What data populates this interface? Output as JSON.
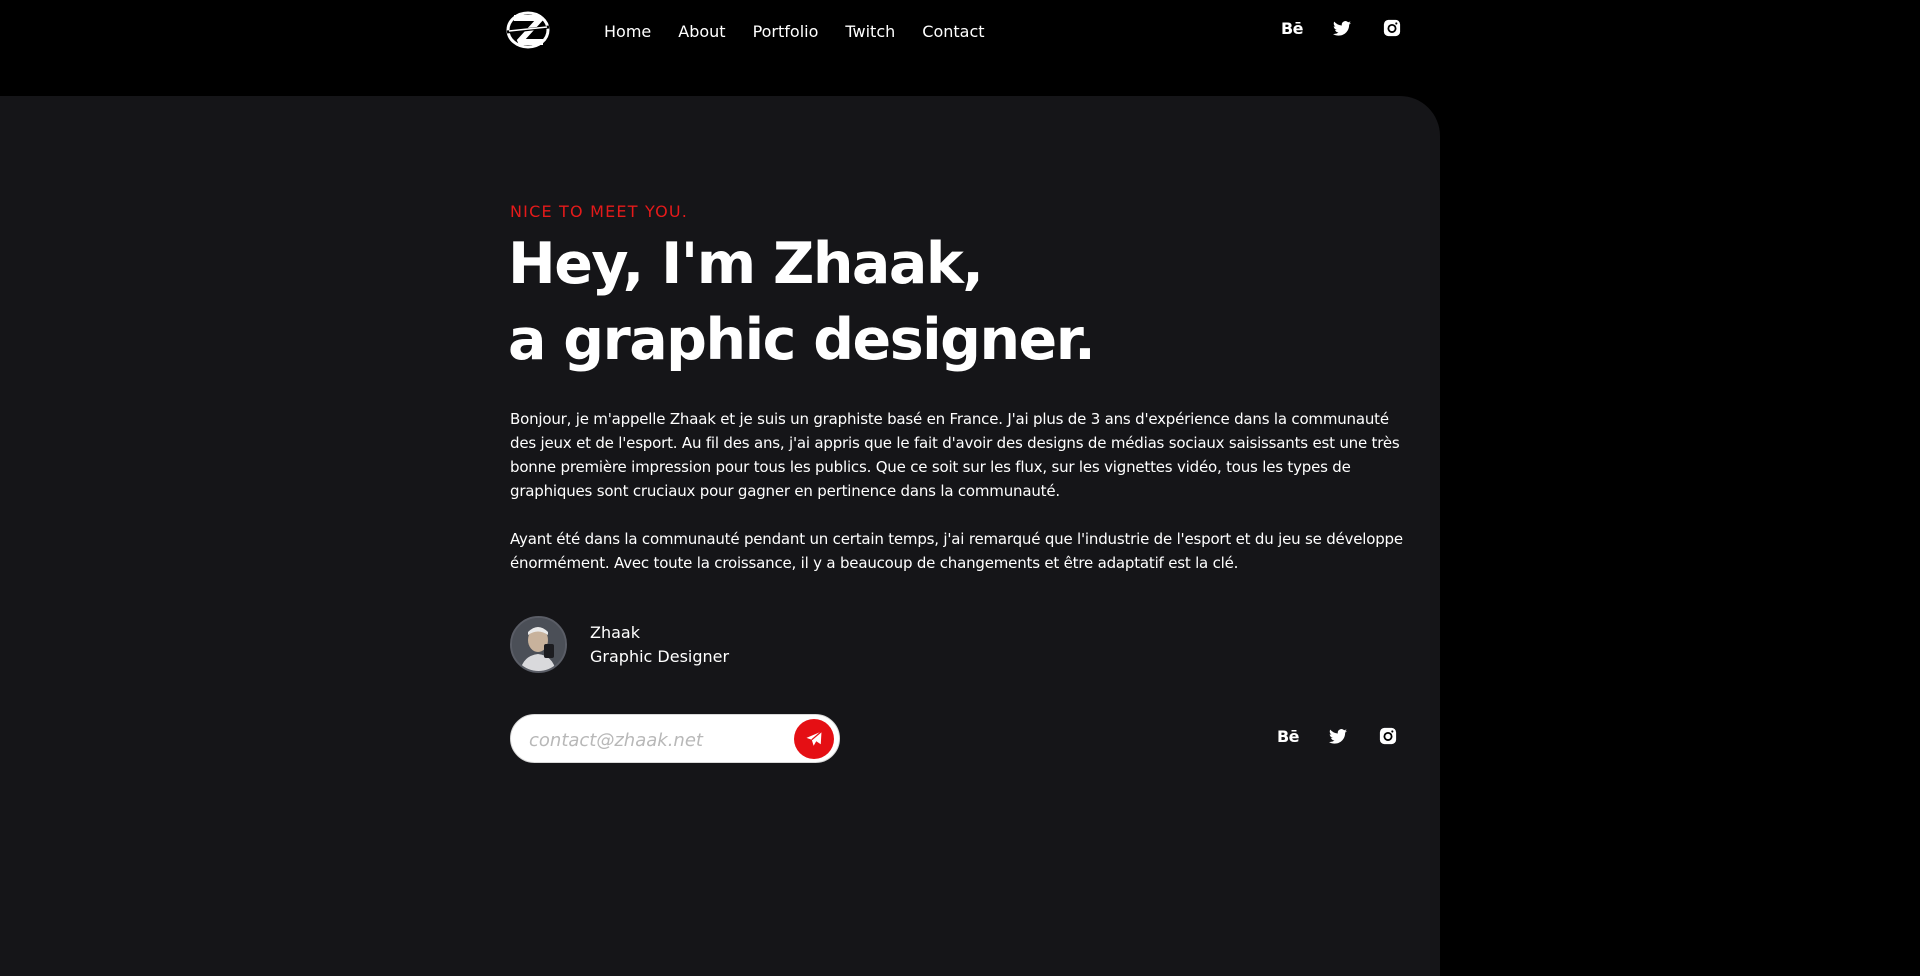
{
  "header": {
    "logo_letter": "Z",
    "nav": [
      {
        "label": "Home"
      },
      {
        "label": "About"
      },
      {
        "label": "Portfolio"
      },
      {
        "label": "Twitch"
      },
      {
        "label": "Contact"
      }
    ],
    "social": [
      {
        "label": "Bē",
        "icon": "behance-icon"
      },
      {
        "label": "",
        "icon": "twitter-icon"
      },
      {
        "label": "",
        "icon": "instagram-icon"
      }
    ]
  },
  "hero": {
    "kicker": "NICE TO MEET YOU.",
    "headline_line1": "Hey, I'm Zhaak,",
    "headline_line2": "a graphic designer.",
    "paragraph1": "Bonjour, je m'appelle Zhaak et je suis un graphiste basé en France. J'ai plus de 3 ans d'expérience dans la communauté des jeux et de l'esport. Au fil des ans, j'ai appris que le fait d'avoir des designs de médias sociaux saisissants est une très bonne première impression pour tous les publics. Que ce soit sur les flux, sur les vignettes vidéo, tous les types de graphiques sont cruciaux pour gagner en pertinence dans la communauté.",
    "paragraph2": "Ayant été dans la communauté pendant un certain temps, j'ai remarqué que l'industrie de l'esport et du jeu se développe énormément. Avec toute la croissance, il y a beaucoup de changements et être adaptatif est la clé."
  },
  "author": {
    "name": "Zhaak",
    "role": "Graphic Designer"
  },
  "contact": {
    "email_placeholder": "contact@zhaak.net",
    "email_value": "",
    "send_icon": "paper-plane-icon"
  },
  "colors": {
    "accent": "#e51a1a",
    "background": "#000000",
    "card": "#151518",
    "text": "#ffffff"
  }
}
